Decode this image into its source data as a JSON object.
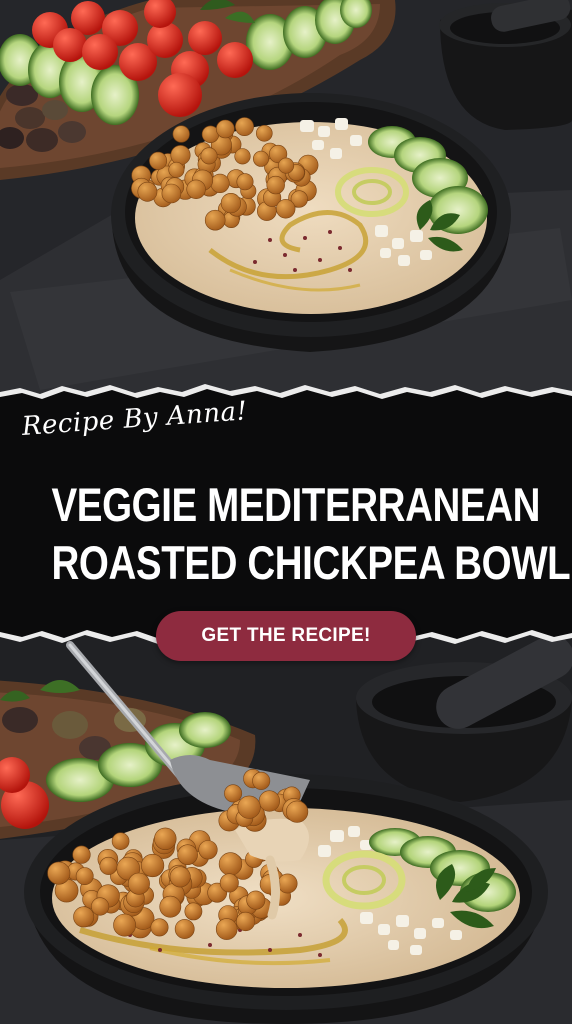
{
  "pin": {
    "byline": "Recipe By Anna!",
    "title_line_1": "VEGGIE MEDITERRANEAN",
    "title_line_2": "ROASTED CHICKPEA BOWL",
    "cta_label": "GET THE RECIPE!"
  },
  "colors": {
    "banner": "#0b0b0c",
    "cta": "#8e2b3f",
    "text": "#ffffff",
    "slate": "#2a2b2e",
    "chickpea": "#c8812f",
    "hummus": "#e6d3b6",
    "cucumber": "#8fbf55",
    "tomato": "#d9261c"
  },
  "icons": [
    "fork-icon",
    "parsley-icon"
  ]
}
